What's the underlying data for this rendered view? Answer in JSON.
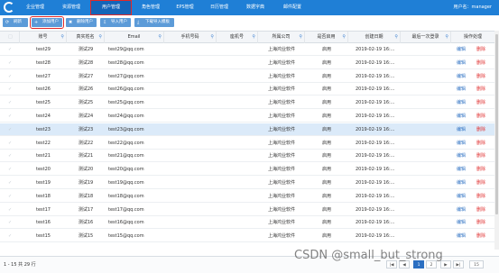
{
  "nav": {
    "items": [
      {
        "label": "企业管理"
      },
      {
        "label": "资源管理"
      },
      {
        "label": "用户管理"
      },
      {
        "label": "角色管理"
      },
      {
        "label": "EPS管理"
      },
      {
        "label": "日历管理"
      },
      {
        "label": "数据字典"
      },
      {
        "label": "邮件配置"
      }
    ],
    "user_label": "用户名：manager"
  },
  "toolbar": {
    "refresh": "刷新",
    "add_user": "添加用户",
    "delete_user": "删除用户",
    "import_user": "导入用户",
    "download_template": "下载导入模板"
  },
  "table": {
    "columns": [
      "账号",
      "真实姓名",
      "Email",
      "手机号码",
      "座机号",
      "所属公司",
      "是否启用",
      "创建日期",
      "最后一次登录",
      "操作处理"
    ],
    "edit_label": "编辑",
    "delete_label": "删除",
    "rows": [
      {
        "account": "test29",
        "name": "测试29",
        "email": "test29@qq.com",
        "company": "上海鸿业软件",
        "enabled": "启用",
        "created": "2019-02-19 16:..."
      },
      {
        "account": "test28",
        "name": "测试28",
        "email": "test28@qq.com",
        "company": "上海鸿业软件",
        "enabled": "启用",
        "created": "2019-02-19 16:..."
      },
      {
        "account": "test27",
        "name": "测试27",
        "email": "test27@qq.com",
        "company": "上海鸿业软件",
        "enabled": "启用",
        "created": "2019-02-19 16:..."
      },
      {
        "account": "test26",
        "name": "测试26",
        "email": "test26@qq.com",
        "company": "上海鸿业软件",
        "enabled": "启用",
        "created": "2019-02-19 16:..."
      },
      {
        "account": "test25",
        "name": "测试25",
        "email": "test25@qq.com",
        "company": "上海鸿业软件",
        "enabled": "启用",
        "created": "2019-02-19 16:..."
      },
      {
        "account": "test24",
        "name": "测试24",
        "email": "test24@qq.com",
        "company": "上海鸿业软件",
        "enabled": "启用",
        "created": "2019-02-19 16:..."
      },
      {
        "account": "test23",
        "name": "测试23",
        "email": "test23@qq.com",
        "company": "上海鸿业软件",
        "enabled": "启用",
        "created": "2019-02-19 16:...",
        "selected": true
      },
      {
        "account": "test22",
        "name": "测试22",
        "email": "test22@qq.com",
        "company": "上海鸿业软件",
        "enabled": "启用",
        "created": "2019-02-19 16:..."
      },
      {
        "account": "test21",
        "name": "测试21",
        "email": "test21@qq.com",
        "company": "上海鸿业软件",
        "enabled": "启用",
        "created": "2019-02-19 16:..."
      },
      {
        "account": "test20",
        "name": "测试20",
        "email": "test20@qq.com",
        "company": "上海鸿业软件",
        "enabled": "启用",
        "created": "2019-02-19 16:..."
      },
      {
        "account": "test19",
        "name": "测试19",
        "email": "test19@qq.com",
        "company": "上海鸿业软件",
        "enabled": "启用",
        "created": "2019-02-19 16:..."
      },
      {
        "account": "test18",
        "name": "测试18",
        "email": "test18@qq.com",
        "company": "上海鸿业软件",
        "enabled": "启用",
        "created": "2019-02-19 16:..."
      },
      {
        "account": "test17",
        "name": "测试17",
        "email": "test17@qq.com",
        "company": "上海鸿业软件",
        "enabled": "启用",
        "created": "2019-02-19 16:..."
      },
      {
        "account": "test16",
        "name": "测试16",
        "email": "test16@qq.com",
        "company": "上海鸿业软件",
        "enabled": "启用",
        "created": "2019-02-19 16:..."
      },
      {
        "account": "test15",
        "name": "测试15",
        "email": "test15@qq.com",
        "company": "上海鸿业软件",
        "enabled": "启用",
        "created": "2019-02-19 16:..."
      }
    ]
  },
  "footer": {
    "summary": "1 - 15 共 29 行",
    "pager": [
      "|◀",
      "◀",
      "1",
      "2",
      "▶",
      "▶|",
      "15"
    ]
  },
  "watermark": "CSDN @small_but_strong",
  "colors": {
    "topbar": "#1f7fd6",
    "accent": "#2b6fc2",
    "delete": "#e03030",
    "highlight": "#e02828"
  }
}
